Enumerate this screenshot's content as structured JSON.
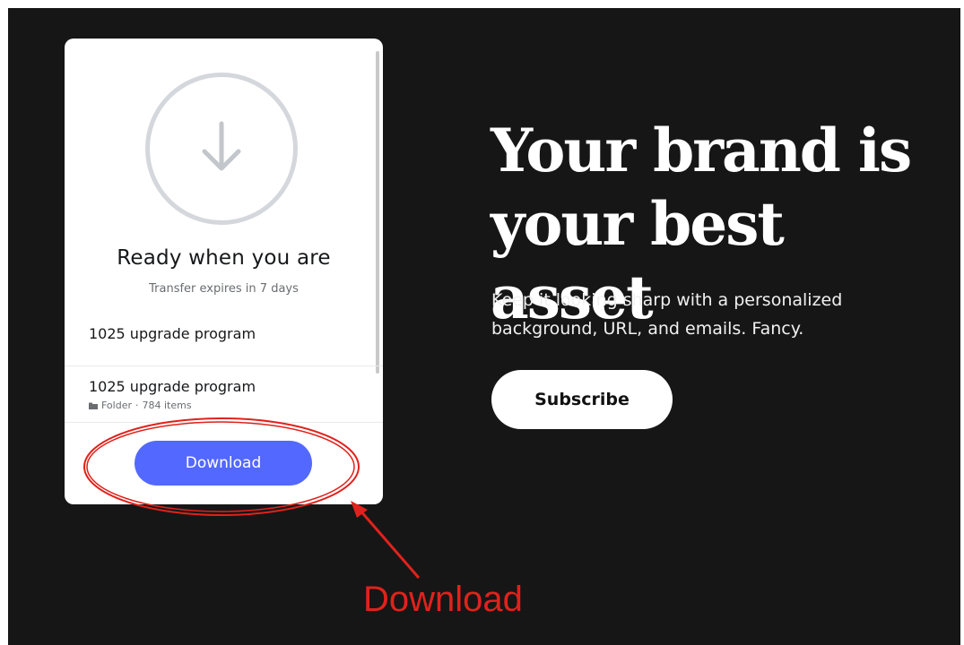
{
  "transfer_card": {
    "title": "Ready when you are",
    "expiry": "Transfer expires in 7 days",
    "items": [
      {
        "name": "1025 upgrade program"
      },
      {
        "name": "1025 upgrade program",
        "type": "Folder",
        "separator": "·",
        "count": "784 items"
      }
    ],
    "download_label": "Download",
    "icon": "download-arrow-icon",
    "accent_color": "#5268ff"
  },
  "promo": {
    "headline_line1": "Your brand is",
    "headline_line2": "your best asset",
    "description": "Keep it looking sharp with a personalized background, URL, and emails. Fancy.",
    "subscribe_label": "Subscribe"
  },
  "annotation": {
    "label": "Download",
    "color": "#e0221c"
  }
}
